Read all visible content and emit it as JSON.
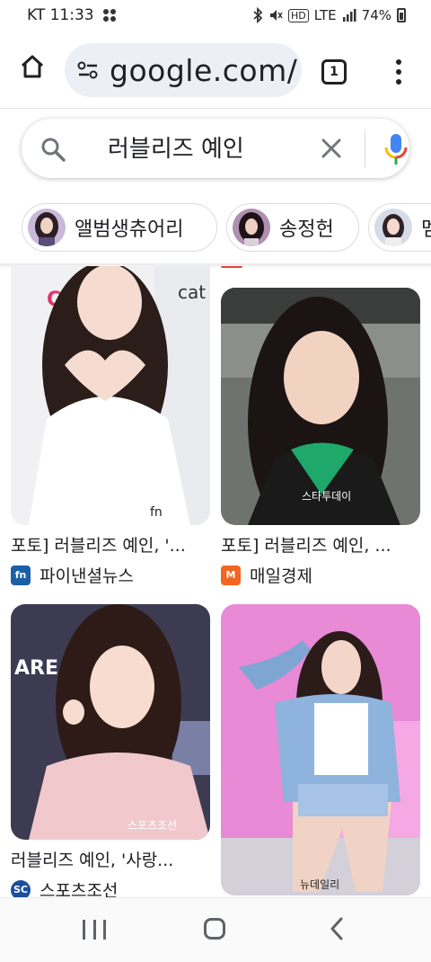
{
  "status_bar": {
    "carrier_time": "KT 11:33",
    "network": "LTE",
    "battery": "74%",
    "hd_label": "HD"
  },
  "browser": {
    "url": "google.com/",
    "tab_count": "1"
  },
  "search": {
    "query": "러블리즈 예인"
  },
  "chips": [
    {
      "label": "앨범생츄어리"
    },
    {
      "label": "송정헌"
    },
    {
      "label": "멤"
    }
  ],
  "results": [
    {
      "title": "포토] 러블리즈 예인, '...",
      "source": "파이낸셜뉴스",
      "logo_text": "fn",
      "logo_color": "#1b5fa8",
      "watermark": "fn"
    },
    {
      "title": "포토] 러블리즈 예인, ...",
      "source": "매일경제",
      "logo_text": "M",
      "logo_color": "#f26522",
      "watermark": "스타투데이"
    },
    {
      "title": "러블리즈 예인, '사랑...",
      "source": "스포츠조선",
      "logo_text": "SC",
      "logo_color": "#1a4fa0",
      "watermark": "스포츠조선"
    },
    {
      "title": "",
      "source": "",
      "logo_text": "",
      "logo_color": "#ffffff",
      "watermark": "뉴데일리"
    }
  ],
  "colors": {
    "accent_blue": "#4285f4",
    "pill_bg": "#eceff5"
  }
}
